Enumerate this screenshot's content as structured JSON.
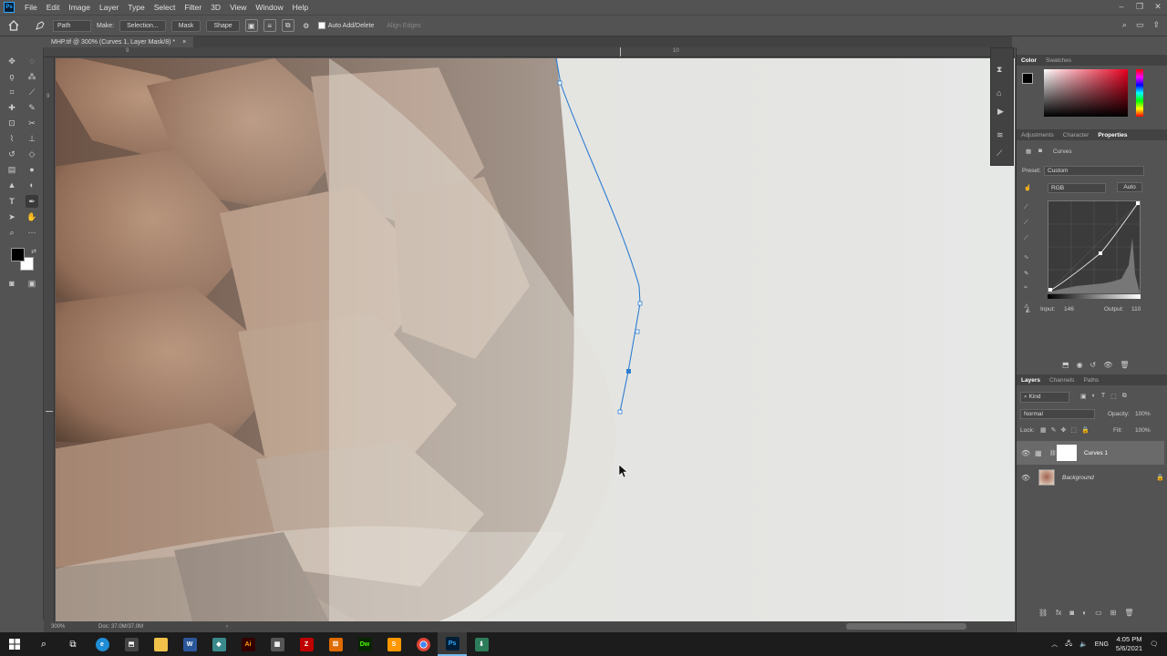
{
  "menu": {
    "logo": "Ps",
    "items": [
      "File",
      "Edit",
      "Image",
      "Layer",
      "Type",
      "Select",
      "Filter",
      "3D",
      "View",
      "Window",
      "Help"
    ]
  },
  "window_controls": {
    "minimize": "–",
    "restore": "❐",
    "close": "✕"
  },
  "options_bar": {
    "mode": "Path",
    "make_label": "Make:",
    "selection_button": "Selection...",
    "mask_button": "Mask",
    "shape_button": "Shape",
    "auto_add_delete": "Auto Add/Delete",
    "align_edges": "Align Edges"
  },
  "document": {
    "tab_title": "MHP.tif @ 300% (Curves 1, Layer Mask/8) *",
    "close": "×"
  },
  "rulers": {
    "top": [
      "9",
      "10"
    ],
    "left": [
      "9"
    ]
  },
  "status": {
    "zoom": "300%",
    "doc": "Doc: 37.0M/37.0M",
    "arrow": "›"
  },
  "color_panel": {
    "tabs": [
      "Color",
      "Swatches"
    ],
    "foreground": "#000000",
    "background": "#ffffff"
  },
  "properties_panel": {
    "tabs": [
      "Adjustments",
      "Character",
      "Properties"
    ],
    "title": "Curves",
    "preset_label": "Preset:",
    "preset_value": "Custom",
    "channel": "RGB",
    "auto_button": "Auto",
    "input_label": "Input:",
    "input_value": "146",
    "output_label": "Output:",
    "output_value": "110"
  },
  "layers_panel": {
    "tabs": [
      "Layers",
      "Channels",
      "Paths"
    ],
    "filter": "Kind",
    "blend_mode": "Normal",
    "opacity_label": "Opacity:",
    "opacity_value": "100%",
    "lock_label": "Lock:",
    "fill_label": "Fill:",
    "fill_value": "100%",
    "layers": [
      {
        "name": "Curves 1"
      },
      {
        "name": "Background"
      }
    ]
  },
  "taskbar": {
    "apps": [
      "start-icon",
      "search-icon",
      "task-view-icon",
      "edge-icon",
      "store-icon",
      "file-explorer-icon",
      "word-icon",
      "app-icon",
      "illustrator-icon",
      "calculator-icon",
      "filezilla-icon",
      "app2-icon",
      "dreamweaver-icon",
      "sublime-icon",
      "chrome-icon",
      "photoshop-icon",
      "downloads-icon"
    ],
    "lang": "ENG",
    "time": "4:05 PM",
    "date": "5/6/2021"
  },
  "colors": {
    "ui_bg": "#535353",
    "ui_dark": "#424242",
    "path_blue": "#2d7dd2",
    "photoshop_blue": "#31a8ff"
  }
}
